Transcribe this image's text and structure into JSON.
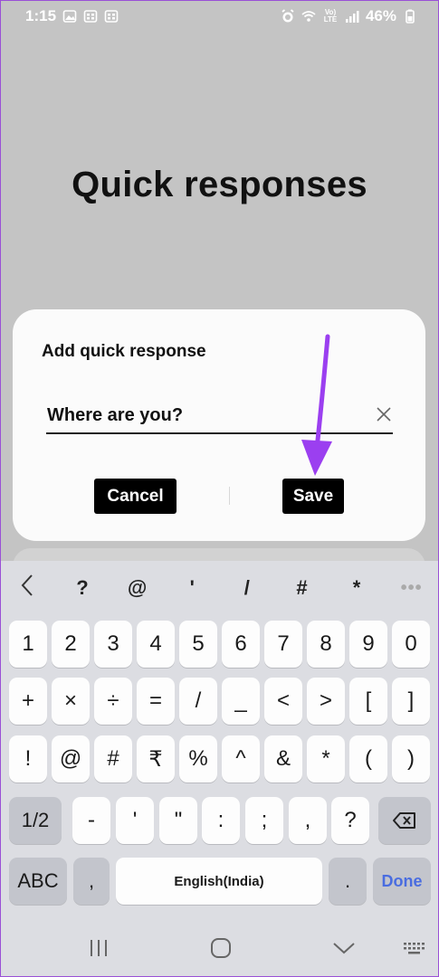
{
  "status_bar": {
    "time": "1:15",
    "network_label": "Vo) LTE",
    "battery": "46%"
  },
  "page": {
    "title": "Quick responses"
  },
  "dialog": {
    "title": "Add quick response",
    "input_value": "Where are you?",
    "input_placeholder": "",
    "cancel_label": "Cancel",
    "save_label": "Save"
  },
  "keyboard": {
    "symbol_bar": [
      "?",
      "@",
      "'",
      "/",
      "#",
      "*"
    ],
    "row1": [
      "1",
      "2",
      "3",
      "4",
      "5",
      "6",
      "7",
      "8",
      "9",
      "0"
    ],
    "row2": [
      "+",
      "×",
      "÷",
      "=",
      "/",
      "_",
      "<",
      ">",
      "[",
      "]"
    ],
    "row3": [
      "!",
      "@",
      "#",
      "₹",
      "%",
      "^",
      "&",
      "*",
      "(",
      ")"
    ],
    "row4": [
      "-",
      "'",
      "\"",
      ":",
      ";",
      ",",
      "?"
    ],
    "shift_label": "1/2",
    "abc_label": "ABC",
    "comma_label": ",",
    "space_label": "English(India)",
    "period_label": ".",
    "done_label": "Done"
  },
  "colors": {
    "accent_arrow": "#9b3ff0",
    "done_text": "#4a6de0",
    "dim_background": "#c4c4c4"
  },
  "icons": [
    "image-icon",
    "grid-icon",
    "alarm-icon",
    "wifi-icon",
    "signal-icon",
    "battery-icon",
    "clear-icon",
    "chevron-left-icon",
    "more-dots-icon",
    "backspace-icon",
    "recents-icon",
    "home-icon",
    "back-icon",
    "keyboard-icon"
  ]
}
